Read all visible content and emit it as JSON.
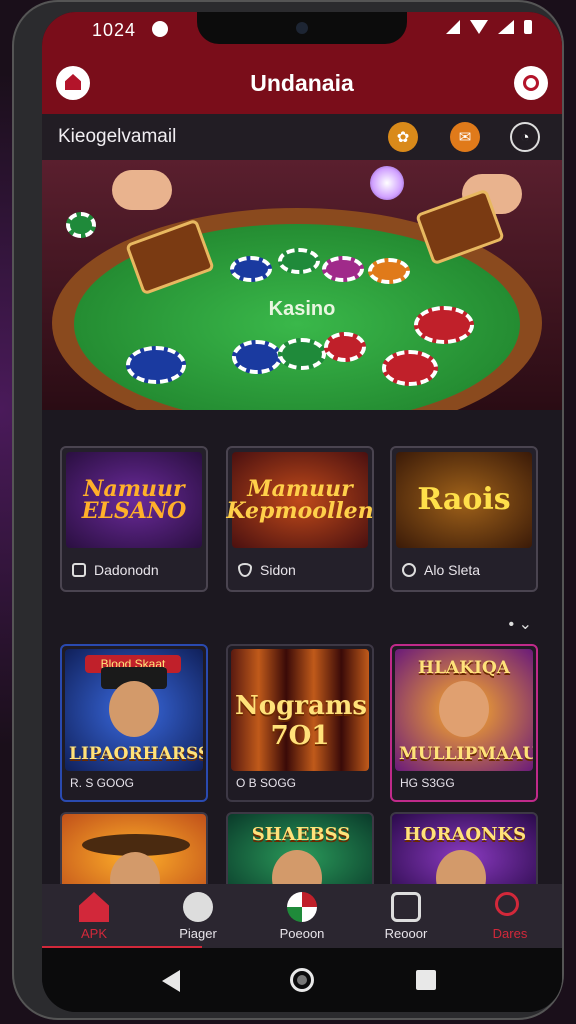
{
  "status_bar": {
    "time": "1024"
  },
  "app_bar": {
    "title": "Undanaia"
  },
  "sub_bar": {
    "label": "Kieogelvamail"
  },
  "hero": {
    "felt_label": "Kasino"
  },
  "categories": [
    {
      "title": "Namuur\nELSANO",
      "label": "Dadonodn",
      "icon": "gift-icon"
    },
    {
      "title": "Mamuur\nKepmoollen",
      "label": "Sidon",
      "icon": "shield-icon"
    },
    {
      "title": "Raois",
      "label": "Alo Sleta",
      "icon": "info-icon"
    }
  ],
  "more": {
    "label": "• ⌄"
  },
  "games": [
    {
      "banner": "LIPAORHARSS",
      "top": "Blood Skaat",
      "sub": "R. S GOOG"
    },
    {
      "banner": "Nograms\n7O1",
      "top": "",
      "sub": "O B SOGG"
    },
    {
      "banner": "MULLIPMAAUN",
      "top": "HLAKIQA",
      "sub": "HG S3GG"
    }
  ],
  "games_row2": [
    {
      "banner": ""
    },
    {
      "banner": "SHAEBSS"
    },
    {
      "banner": "HORAONKS"
    }
  ],
  "bottom_nav": [
    {
      "label": "APK",
      "icon": "home-icon"
    },
    {
      "label": "Piager",
      "icon": "player-icon"
    },
    {
      "label": "Poeoon",
      "icon": "roulette-icon"
    },
    {
      "label": "Reooor",
      "icon": "chat-icon"
    },
    {
      "label": "Dares",
      "icon": "search-icon"
    }
  ],
  "colors": {
    "accent": "#7a0d1a",
    "active": "#d2283a",
    "felt": "#2aa43a"
  }
}
